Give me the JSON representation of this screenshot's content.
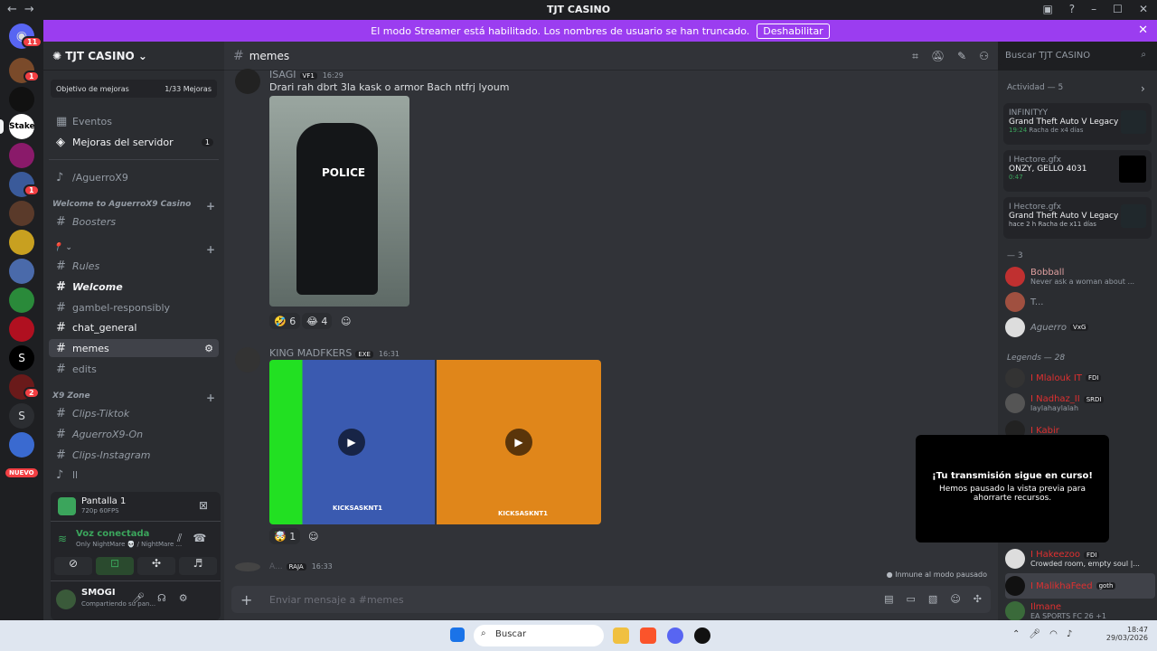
{
  "window": {
    "title": "TJT CASINO"
  },
  "banner": {
    "text": "El modo Streamer está habilitado. Los nombres de usuario se han truncado.",
    "button": "Deshabilitar"
  },
  "guilds": {
    "badges": [
      "11",
      "1",
      "1",
      "2",
      "1",
      "2"
    ],
    "letter": "S",
    "new_label": "NUEVO"
  },
  "server": {
    "name": "TJT CASINO",
    "boost_label": "Objetivo de mejoras",
    "boost_count": "1/33 Mejoras",
    "events": "Eventos",
    "boosts_server": "Mejoras del servidor",
    "boosts_badge": "1",
    "voice_channel": "/AguerroX9",
    "cat1": "Welcome to AguerroX9 Casino",
    "boosters": "Boosters",
    "cat2": "📍 ⌄",
    "rules": "Rules",
    "welcome": "Welcome",
    "gamble": "gambel-responsibly",
    "chat": "chat_general",
    "memes": "memes",
    "edits": "edits",
    "cat3": "X9 Zone",
    "tiktok": "Clips-Tiktok",
    "on": "AguerroX9-On",
    "insta": "Clips-Instagram",
    "ll": "ll"
  },
  "voice": {
    "screen": "Pantalla 1",
    "screen_sub": "720p 60FPS",
    "connected": "Voz conectada",
    "conn_sub": "Only NightMare 💀 / NightMare ...",
    "user": "SMOGI",
    "user_status": "Compartiendo su pan..."
  },
  "channel": {
    "name": "memes",
    "search": "Buscar TJT CASINO",
    "composer": "Enviar mensaje a #memes"
  },
  "messages": [
    {
      "user": "ISAGI",
      "tag": "VF1",
      "time": "16:29",
      "text": "Drari rah dbrt 3la kask o armor Bach ntfrj lyoum",
      "image_text": "POLICE",
      "reactions": [
        "🤣 6",
        "😂 4"
      ]
    },
    {
      "user": "KING MADFKERS",
      "tag": "EXE",
      "time": "16:31",
      "clip_text": "KICKSASKNT1",
      "reactions": [
        "🤯 1"
      ]
    },
    {
      "user": "A...",
      "tag": "RAJA",
      "time": "16:33"
    }
  ],
  "paused_note": "Inmune al modo pausado",
  "members": {
    "activity_header": "Actividad — 5",
    "activities": [
      {
        "user": "INFINITYY",
        "game": "Grand Theft Auto V Legacy",
        "detail": "19:24",
        "detail2": "Racha de x4 días"
      },
      {
        "user": "I Hectore.gfx",
        "game": "ONZY, GELLO 4031",
        "detail": "0:47",
        "detail2": ""
      },
      {
        "user": "I Hectore.gfx",
        "game": "Grand Theft Auto V Legacy",
        "detail": "hace 2 h",
        "detail2": "Racha de x11 días"
      }
    ],
    "group1": "— 3",
    "g1": [
      {
        "name": "Bobball",
        "sub": "Never ask a woman about ..."
      },
      {
        "name": "T...",
        "sub": ""
      },
      {
        "name": "Aguerro",
        "tag": "VxG"
      }
    ],
    "group2": "Legends — 28",
    "g2": [
      {
        "name": "I Mlalouk IT",
        "tag": "FDI"
      },
      {
        "name": "I Nadhaz_II",
        "tag": "SRDI",
        "sub": "laylahaylalah"
      },
      {
        "name": "I Kabir",
        "tag": ""
      },
      {
        "name": "I Hakeezoo",
        "tag": "FDI",
        "sub": "Crowded room, empty soul |..."
      },
      {
        "name": "I MalikhaFeed",
        "tag": "goth"
      },
      {
        "name": "Ilmane",
        "sub": "EA SPORTS FC 26 +1"
      }
    ]
  },
  "toast": {
    "title": "¡Tu transmisión sigue en curso!",
    "body": "Hemos pausado la vista previa para ahorrarte recursos."
  },
  "taskbar": {
    "search": "Buscar",
    "time": "18:47",
    "date": "29/03/2026"
  }
}
